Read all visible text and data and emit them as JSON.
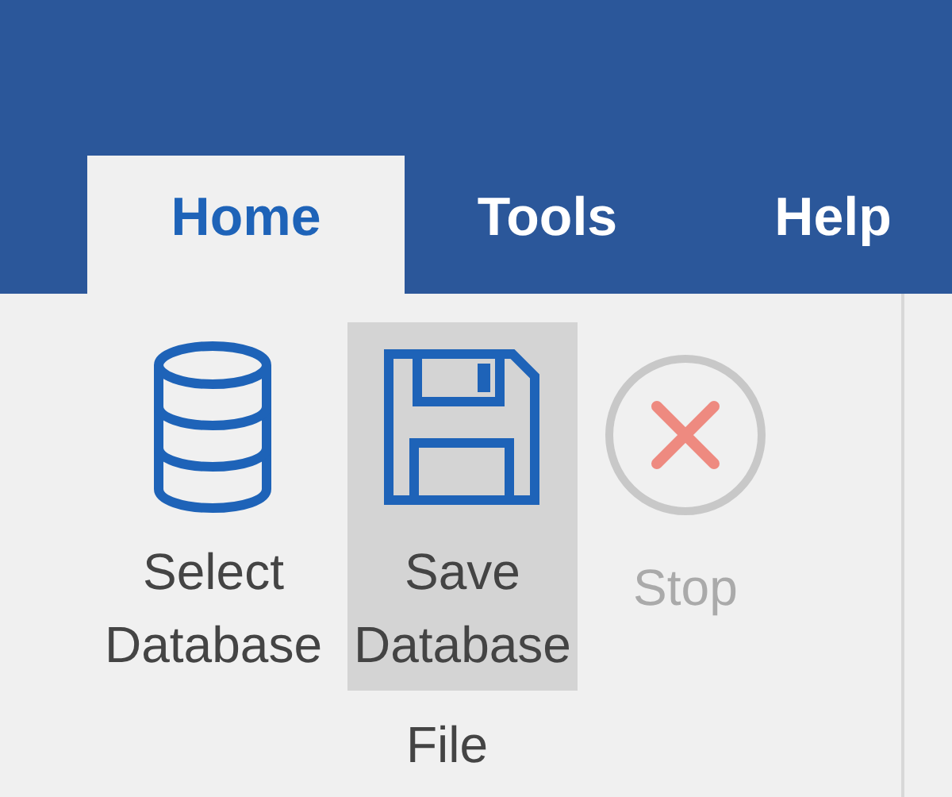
{
  "tabs": [
    {
      "label": "Home",
      "selected": true
    },
    {
      "label": "Tools",
      "selected": false
    },
    {
      "label": "Help",
      "selected": false
    }
  ],
  "group": {
    "label": "File",
    "buttons": [
      {
        "kind": "database",
        "label": "Select Database",
        "highlighted": false,
        "disabled": false
      },
      {
        "kind": "save",
        "label": "Save Database",
        "highlighted": true,
        "disabled": false
      },
      {
        "kind": "stop",
        "label": "Stop",
        "highlighted": false,
        "disabled": true
      }
    ]
  }
}
